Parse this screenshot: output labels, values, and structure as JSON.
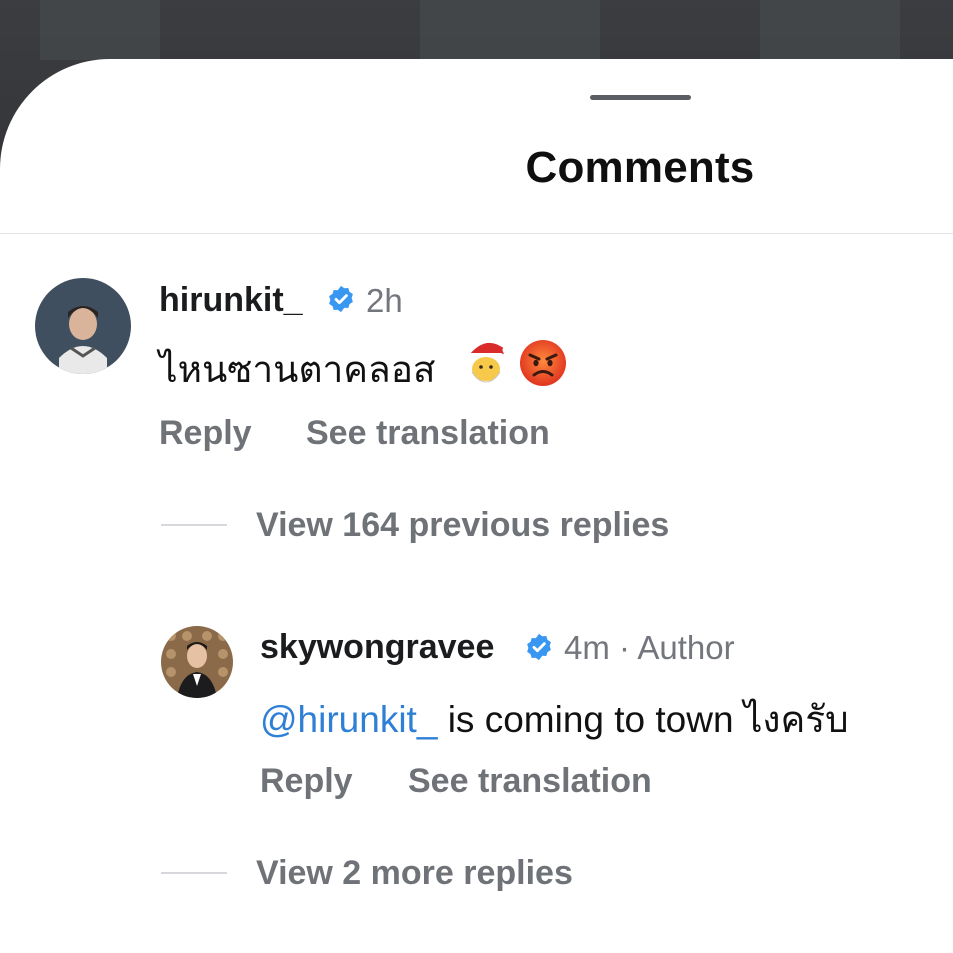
{
  "sheet": {
    "title": "Comments"
  },
  "comments": [
    {
      "username": "hirunkit_",
      "time": "2h",
      "text": "ไหนซานตาคลอส",
      "emojis": [
        "santa-emoji",
        "angry-face-emoji"
      ],
      "actions": {
        "reply": "Reply",
        "translate": "See translation"
      },
      "view_replies": "View 164 previous replies"
    }
  ],
  "replies": [
    {
      "username": "skywongravee",
      "time": "4m",
      "separator": "·",
      "role": "Author",
      "mention": "@hirunkit_",
      "text": " is coming to town ไงครับ",
      "actions": {
        "reply": "Reply",
        "translate": "See translation"
      }
    }
  ],
  "more_replies": "View 2 more replies",
  "colors": {
    "verified": "#3897f0",
    "mention": "#2e7fd6",
    "secondary": "#6f7277"
  }
}
